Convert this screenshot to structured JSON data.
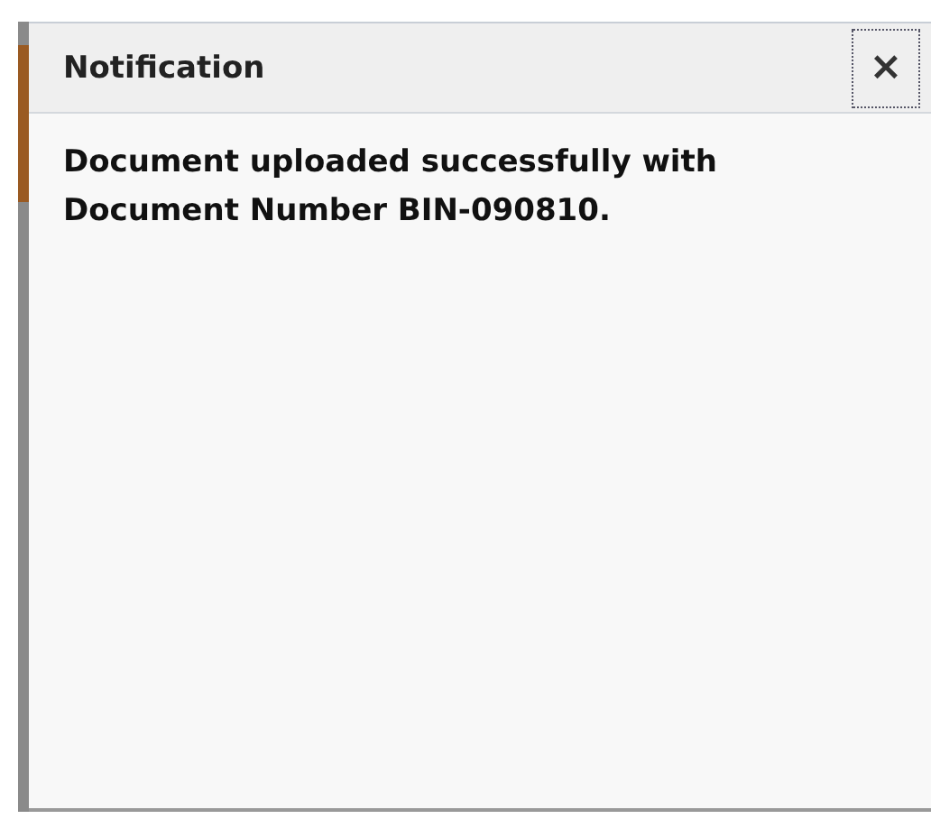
{
  "dialog": {
    "title": "Notification",
    "close_label": "×",
    "message": "Document uploaded successfully with Document Number BIN-090810."
  }
}
